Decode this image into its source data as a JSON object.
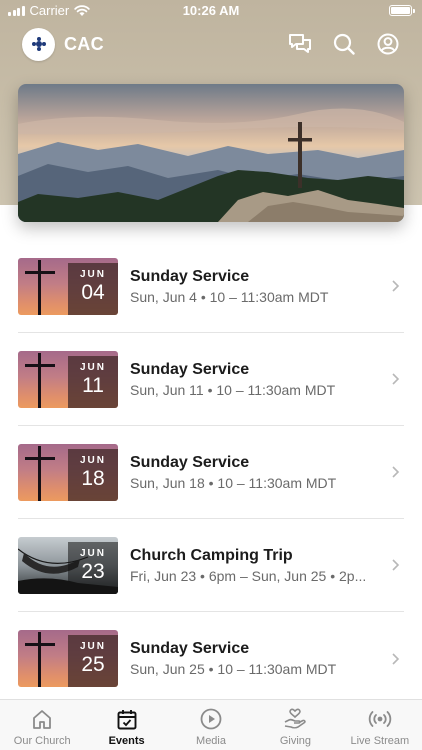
{
  "status_bar": {
    "carrier": "Carrier",
    "time": "10:26 AM"
  },
  "header": {
    "title": "CAC",
    "icons": [
      "chat-icon",
      "search-icon",
      "profile-icon"
    ]
  },
  "hero": {
    "image": "mountain-cross-landscape"
  },
  "events": [
    {
      "title": "Sunday Service",
      "subtitle": "Sun, Jun 4 • 10 – 11:30am MDT",
      "month": "JUN",
      "day": "04",
      "thumb": "sunset-cross"
    },
    {
      "title": "Sunday Service",
      "subtitle": "Sun, Jun 11 • 10 – 11:30am MDT",
      "month": "JUN",
      "day": "11",
      "thumb": "sunset-cross"
    },
    {
      "title": "Sunday Service",
      "subtitle": "Sun, Jun 18 • 10 – 11:30am MDT",
      "month": "JUN",
      "day": "18",
      "thumb": "sunset-cross"
    },
    {
      "title": "Church Camping Trip",
      "subtitle": "Fri, Jun 23 • 6pm – Sun, Jun 25 • 2p...",
      "month": "JUN",
      "day": "23",
      "thumb": "hammock"
    },
    {
      "title": "Sunday Service",
      "subtitle": "Sun, Jun 25 • 10 – 11:30am MDT",
      "month": "JUN",
      "day": "25",
      "thumb": "sunset-cross"
    }
  ],
  "tabs": [
    {
      "label": "Our Church",
      "icon": "home-icon",
      "active": false
    },
    {
      "label": "Events",
      "icon": "calendar-icon",
      "active": true
    },
    {
      "label": "Media",
      "icon": "play-icon",
      "active": false
    },
    {
      "label": "Giving",
      "icon": "giving-hand-icon",
      "active": false
    },
    {
      "label": "Live Stream",
      "icon": "broadcast-icon",
      "active": false
    }
  ]
}
